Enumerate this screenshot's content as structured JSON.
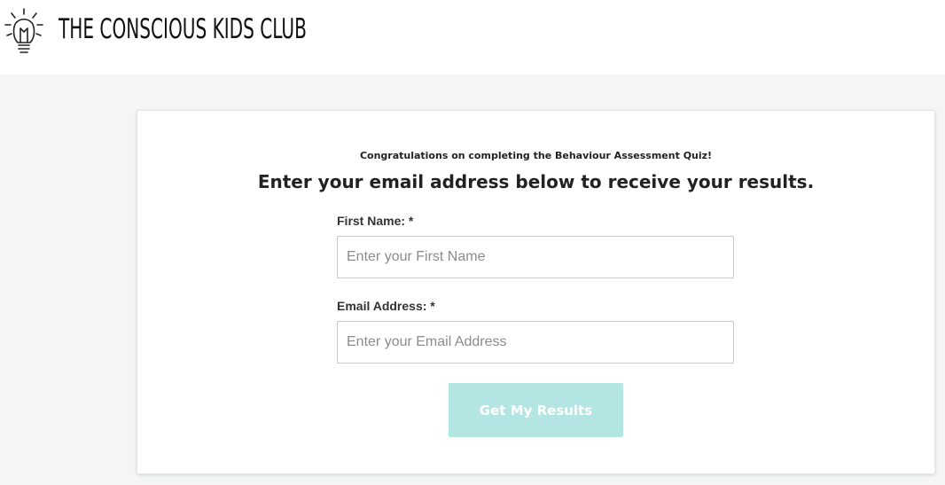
{
  "brand": {
    "name": "THE CONSCIOUS KIDS CLUB",
    "icon": "lightbulb-icon"
  },
  "form": {
    "congrats": "Congratulations on completing the Behaviour Assessment Quiz!",
    "headline": "Enter your email address below to receive your results.",
    "first_name": {
      "label": "First Name: *",
      "placeholder": "Enter your First Name",
      "value": ""
    },
    "email": {
      "label": "Email Address: *",
      "placeholder": "Enter your Email Address",
      "value": ""
    },
    "submit_label": "Get My Results"
  },
  "colors": {
    "button_bg": "#b3e5e2",
    "page_bg": "#f4f5f6"
  }
}
